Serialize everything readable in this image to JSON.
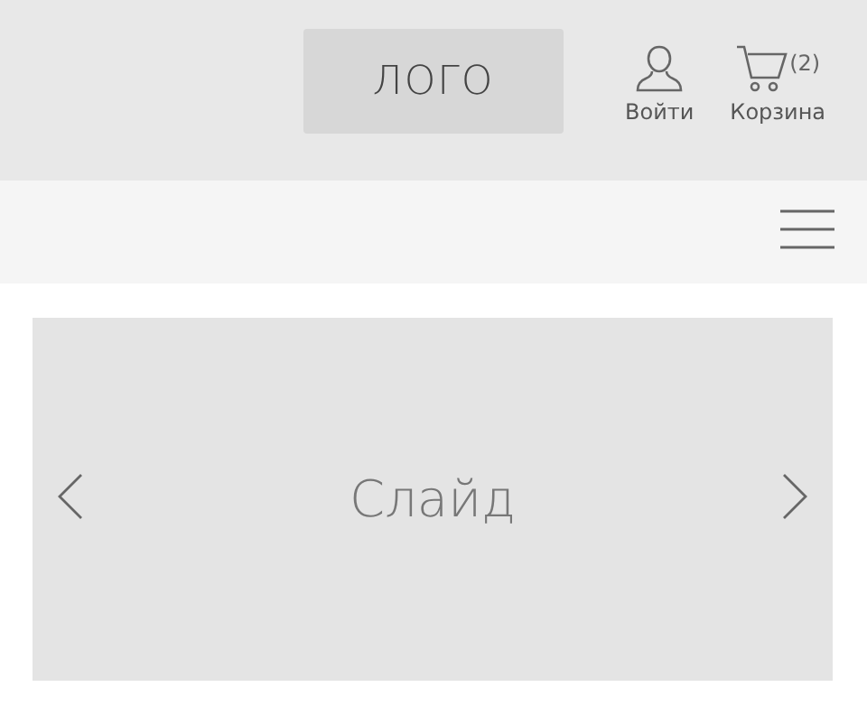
{
  "header": {
    "logo": "ЛОГО",
    "login": {
      "label": "Войти"
    },
    "cart": {
      "label": "Корзина",
      "count": "(2)"
    }
  },
  "slider": {
    "slide_text": "Слайд"
  }
}
